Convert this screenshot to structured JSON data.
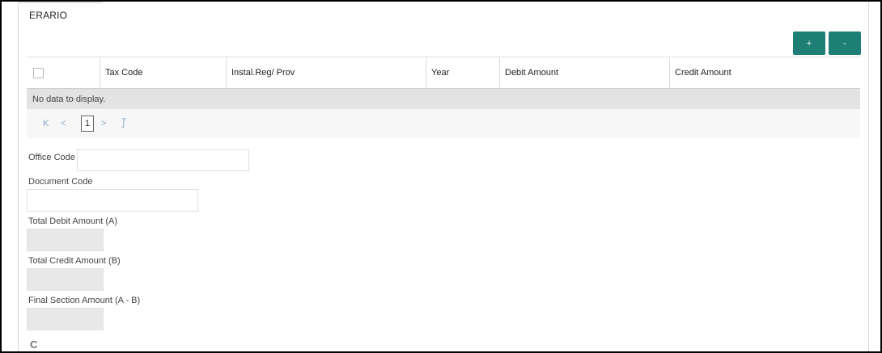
{
  "section": {
    "title": "ERARIO"
  },
  "toolbar": {
    "add_label": "+",
    "remove_label": "-"
  },
  "table": {
    "columns": [
      "Tax Code",
      "Instal.Reg/ Prov",
      "Year",
      "Debit Amount",
      "Credit Amount"
    ],
    "empty_message": "No data to display."
  },
  "pagination": {
    "first": "K",
    "prev": "<",
    "current_page": "1",
    "next": ">",
    "last": "⨛"
  },
  "form": {
    "office_code": {
      "label": "Office Code",
      "value": ""
    },
    "document_code": {
      "label": "Document Code",
      "value": ""
    },
    "total_debit": {
      "label": "Total Debit Amount (A)",
      "value": ""
    },
    "total_credit": {
      "label": "Total Credit Amount (B)",
      "value": ""
    },
    "final_section": {
      "label": "Final Section Amount (A - B)",
      "value": ""
    }
  },
  "footer": {
    "refresh_icon": "C"
  },
  "colors": {
    "accent": "#1d7f76",
    "row_empty_bg": "#e3e3e3",
    "pager_link": "#8aa4c8"
  }
}
